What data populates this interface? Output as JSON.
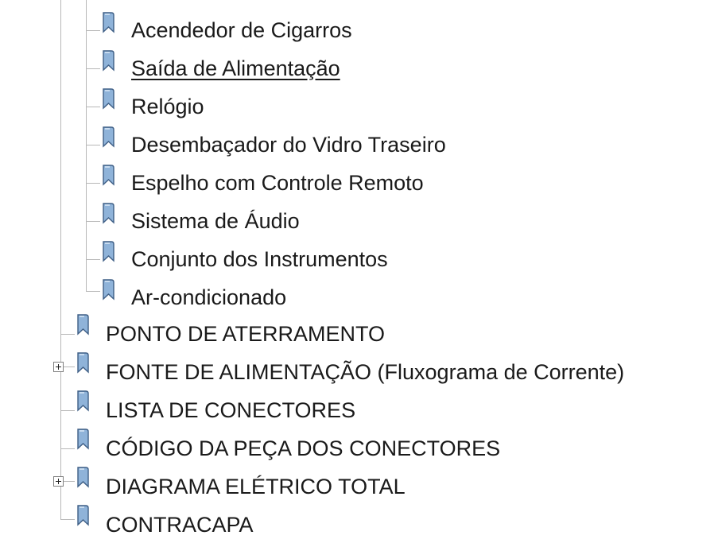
{
  "tree": {
    "children_level2": [
      {
        "label": "Acendedor de Cigarros"
      },
      {
        "label": "Saída de Alimentação"
      },
      {
        "label": "Relógio"
      },
      {
        "label": "Desembaçador do Vidro Traseiro"
      },
      {
        "label": "Espelho com Controle Remoto"
      },
      {
        "label": "Sistema de Áudio"
      },
      {
        "label": "Conjunto dos Instrumentos"
      },
      {
        "label": "Ar-condicionado"
      }
    ],
    "children_level1": [
      {
        "label": "PONTO DE ATERRAMENTO",
        "expandable": false
      },
      {
        "label": "FONTE DE ALIMENTAÇÃO (Fluxograma de Corrente)",
        "expandable": true
      },
      {
        "label": "LISTA DE CONECTORES",
        "expandable": false
      },
      {
        "label": "CÓDIGO DA PEÇA DOS CONECTORES",
        "expandable": false
      },
      {
        "label": "DIAGRAMA ELÉTRICO TOTAL",
        "expandable": true
      },
      {
        "label": "CONTRACAPA",
        "expandable": false
      }
    ]
  },
  "icons": {
    "node": "bookmark-icon",
    "expand": "plus-box-icon"
  },
  "colors": {
    "bookmark_fill": "#8fb3d9",
    "bookmark_stroke": "#3f5f86",
    "tree_line": "#b8b8b8"
  }
}
